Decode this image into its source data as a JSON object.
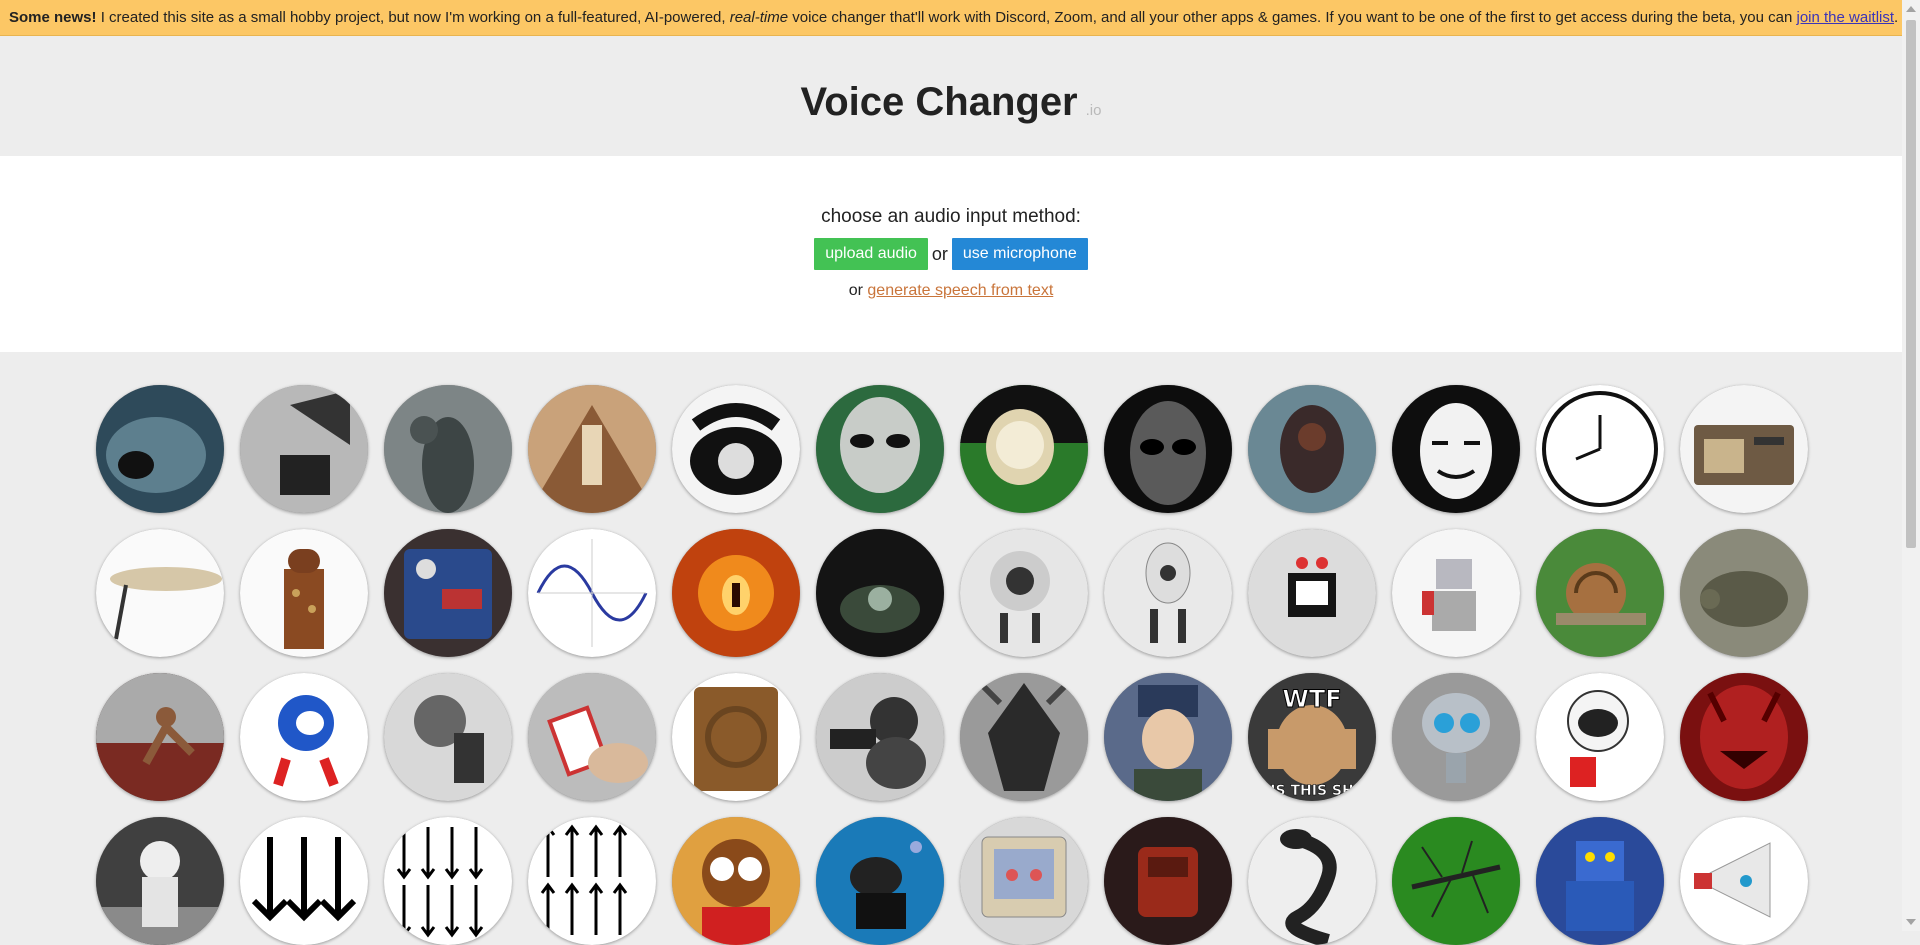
{
  "banner": {
    "bold": "Some news!",
    "text1": " I created this site as a small hobby project, but now I'm working on a full-featured, AI-powered, ",
    "italic": "real-time",
    "text2": " voice changer that'll work with Discord, Zoom, and all your other apps & games. If you want to be one of the first to get access during the beta, you can ",
    "link": "join the waitlist",
    "end": "."
  },
  "header": {
    "title": "Voice Changer",
    "suffix": ".io"
  },
  "input": {
    "prompt": "choose an audio input method:",
    "upload_label": "upload audio",
    "or1": "or",
    "mic_label": "use microphone",
    "or2": "or",
    "tts_link": "generate speech from text"
  },
  "voices": [
    {
      "name": "sea-monster-icon",
      "icon": "sea monster"
    },
    {
      "name": "gramophone-horn-icon",
      "icon": "gramophone horn"
    },
    {
      "name": "ghost-hand-icon",
      "icon": "ghost behind glass"
    },
    {
      "name": "cathedral-icon",
      "icon": "cathedral interior"
    },
    {
      "name": "rotary-telephone-icon",
      "icon": "rotary telephone"
    },
    {
      "name": "alien-icon",
      "icon": "grey alien"
    },
    {
      "name": "melting-clock-icon",
      "icon": "melting clock"
    },
    {
      "name": "dark-alien-icon",
      "icon": "dark alien"
    },
    {
      "name": "robot-head-icon",
      "icon": "robot head"
    },
    {
      "name": "anonymous-mask-icon",
      "icon": "anonymous mask"
    },
    {
      "name": "reversed-clock-icon",
      "icon": "reversed clock"
    },
    {
      "name": "radio-icon",
      "icon": "vintage radio"
    },
    {
      "name": "cymbal-icon",
      "icon": "cymbal"
    },
    {
      "name": "dalek-icon",
      "icon": "dalek"
    },
    {
      "name": "effects-pedal-icon",
      "icon": "effects pedal"
    },
    {
      "name": "sine-wave-icon",
      "icon": "sine wave"
    },
    {
      "name": "fire-demon-icon",
      "icon": "fire demon"
    },
    {
      "name": "cave-icon",
      "icon": "cave"
    },
    {
      "name": "white-robot-icon",
      "icon": "white robot"
    },
    {
      "name": "white-robot-2-icon",
      "icon": "white robot two"
    },
    {
      "name": "tv-robot-icon",
      "icon": "tv robot"
    },
    {
      "name": "toy-robot-icon",
      "icon": "toy robot"
    },
    {
      "name": "snail-icon",
      "icon": "snail"
    },
    {
      "name": "turtle-icon",
      "icon": "turtle"
    },
    {
      "name": "sprinter-icon",
      "icon": "sprinter"
    },
    {
      "name": "sonic-icon",
      "icon": "sonic"
    },
    {
      "name": "soldier-radio-icon",
      "icon": "soldier with radio"
    },
    {
      "name": "card-trick-icon",
      "icon": "playing cards"
    },
    {
      "name": "wooden-speaker-icon",
      "icon": "wooden speaker"
    },
    {
      "name": "bell-telephone-icon",
      "icon": "early telephone"
    },
    {
      "name": "dark-lord-icon",
      "icon": "dark armored figure"
    },
    {
      "name": "russian-soldier-icon",
      "icon": "man in ushanka"
    },
    {
      "name": "wtf-meme-icon",
      "icon": "wtf meme"
    },
    {
      "name": "gir-robot-icon",
      "icon": "small robot"
    },
    {
      "name": "kirobo-robot-icon",
      "icon": "tiny robot"
    },
    {
      "name": "red-devil-icon",
      "icon": "red devil"
    },
    {
      "name": "astronaut-icon",
      "icon": "astronaut"
    },
    {
      "name": "arrows-down-big-icon",
      "icon": "arrows down large"
    },
    {
      "name": "arrows-down-small-icon",
      "icon": "arrows down small"
    },
    {
      "name": "arrows-up-icon",
      "icon": "arrows up"
    },
    {
      "name": "chipmunk-icon",
      "icon": "chipmunk"
    },
    {
      "name": "scuba-diver-icon",
      "icon": "scuba diver"
    },
    {
      "name": "retro-computer-icon",
      "icon": "retro computer"
    },
    {
      "name": "red-robot-icon",
      "icon": "red robot"
    },
    {
      "name": "cobra-robot-icon",
      "icon": "cobra"
    },
    {
      "name": "mosquito-icon",
      "icon": "mosquito"
    },
    {
      "name": "blue-robot-icon",
      "icon": "blue robot"
    },
    {
      "name": "megaphone-icon",
      "icon": "megaphone"
    }
  ],
  "grid_text": {
    "wtf": "WTF",
    "wtf_bottom": "IS THIS SH"
  },
  "colors": {
    "banner_bg": "#fcc765",
    "upload_btn": "#43c254",
    "mic_btn": "#2488d6",
    "tts_link": "#c9753b",
    "waitlist_link": "#3b34b8"
  }
}
